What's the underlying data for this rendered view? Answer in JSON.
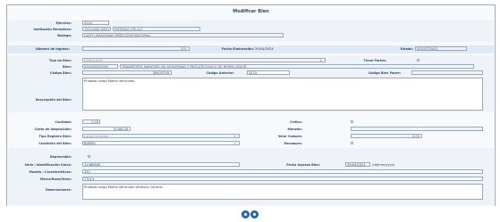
{
  "form": {
    "title": "Modificar Bien",
    "ejercicio_label": "Ejercicio:",
    "ejercicio_value": "2024",
    "institucion_label": "Institución Receptora:",
    "institucion_code": "135-0000-0000",
    "institucion_name": "ENTIDAD 135-0-0",
    "bodega_label": "Bodega:",
    "bodega_value": "QUITO AMAZONAS DIRECCION NACIONAL",
    "ingreso_label": "Número de Ingreso:",
    "ingreso_value": "201",
    "fecha_elab_label": "Fecha Elaboración:",
    "fecha_elab_value": "29/04/2024",
    "estado_label": "Estado:",
    "estado_value": "REGISTRADO",
    "tipo_bien_label": "Tipo de Bien:",
    "tipo_bien_value": "VEHICULOS",
    "tiene_partes_label": "Tiene Partes:",
    "bien_label": "Bien:",
    "bien_code": "530208020005",
    "bien_name": "TRANSPORTE MARITIMO DE SEGURIDAD Y RESCATE/CASCO DE REMOLCADOR",
    "codigo_bien_label": "Código Bien:",
    "codigo_bien_value": "38409708",
    "codigo_anterior_label": "Código Anterior:",
    "codigo_anterior_value": "3215",
    "codigo_padre_label": "Código Bien Padre:",
    "descripcion_label": "Descripción del Bien:",
    "descripcion_value": "Pruebas cargo Matriz Vehículos.",
    "cantidad_label": "Cantidad:",
    "cantidad_value": "1.00",
    "critico_label": "Crítico:",
    "costo_label": "Costo de Adquisición:",
    "costo_value": "5,000.00",
    "moneda_label": "Moneda:",
    "tipo_registro_label": "Tipo Registro Bien:",
    "tipo_registro_value": "Largo Duración",
    "valor_compra_label": "Valor Compra:",
    "valor_compra_value": "0.00",
    "condicion_label": "Condición del Bien:",
    "condicion_value": "BUENO",
    "recompra_label": "Recompra:",
    "depreciable_label": "Depreciable:",
    "serie_label": "Serie / Identificación Única:",
    "serie_value": "11465645",
    "fecha_ingreso_label": "Fecha Ingreso Bien:",
    "fecha_ingreso_value": "29/04/2024",
    "fecha_ingreso_hint": "(dd/mm/yyyy)",
    "modelo_label": "Modelo / Características:",
    "modelo_value": "252",
    "marca_label": "Marca/Raza/Otros:",
    "marca_value": "TT213",
    "observaciones_label": "Observaciones:",
    "observaciones_value": "Pruebas cargo Matriz Vehículos Verónica Carrera."
  },
  "icons": {
    "caret": "▾"
  },
  "colors": {
    "frame_border": "#8fb0d6",
    "band": "#dfe8f5",
    "label": "#2e4a70",
    "button": "#2f6fb3"
  }
}
